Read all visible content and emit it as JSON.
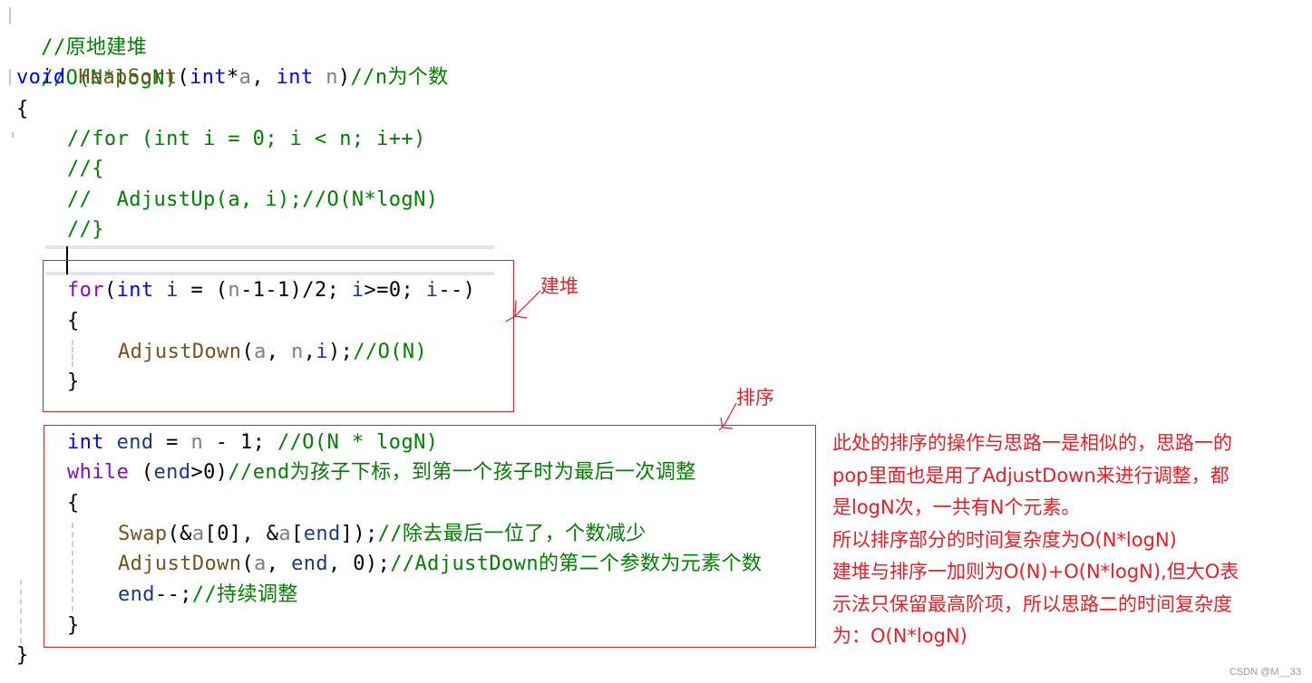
{
  "code": {
    "comment_title": "//原地建堆",
    "comment_complexity": "//O(N*logN)",
    "signature": {
      "kw_void": "void",
      "fn_name": "HeapSort",
      "open": "(",
      "kw_int1": "int",
      "star": "*",
      "param_a": "a",
      "comma": ", ",
      "kw_int2": "int",
      "space": " ",
      "param_n": "n",
      "close": ")",
      "comment": "//n为个数"
    },
    "open_brace": "{",
    "close_brace": "}",
    "commented_loop": [
      "//for (int i = 0; i < n; i++)",
      "//{",
      "//  AdjustUp(a, i);//O(N*logN)",
      "//}"
    ],
    "build_heap": {
      "for_kw": "for",
      "for_open": "(",
      "int_kw": "int",
      "i_decl": " i",
      "eq": " = (",
      "n": "n",
      "rest": "-1-1)/2; ",
      "i2": "i",
      "cond": ">=0; ",
      "i3": "i",
      "dec": "--)",
      "brace_open": "{",
      "call_fn": "AdjustDown",
      "call_open": "(",
      "call_a": "a",
      "call_sep": ", ",
      "call_n": "n",
      "call_comma": ",",
      "call_i": "i",
      "call_close": ");",
      "call_comment": "//O(N)",
      "brace_close": "}"
    },
    "sort_loop": {
      "int_kw": "int",
      "end_var": " end",
      "assign": " = ",
      "n": "n",
      "minus": " - 1; ",
      "comment1": "//O(N * logN)",
      "while_kw": "while",
      "while_open": " (",
      "while_end": "end",
      "while_cond": ">0)",
      "while_comment": "//end为孩子下标，到第一个孩子时为最后一次调整",
      "brace_open": "{",
      "swap_fn": "Swap",
      "swap_open": "(&",
      "swap_a1": "a",
      "swap_idx0": "[0], &",
      "swap_a2": "a",
      "swap_lb": "[",
      "swap_end": "end",
      "swap_rb": "]);",
      "swap_comment": "//除去最后一位了，个数减少",
      "adj_fn": "AdjustDown",
      "adj_open": "(",
      "adj_a": "a",
      "adj_sep": ", ",
      "adj_end": "end",
      "adj_rest": ", 0);",
      "adj_comment": "//AdjustDown的第二个参数为元素个数",
      "dec_end": "end",
      "dec_op": "--;",
      "dec_comment": "//持续调整",
      "brace_close": "}"
    }
  },
  "annotations": {
    "build_heap_label": "建堆",
    "sort_label": "排序",
    "explanation": [
      "此处的排序的操作与思路一是相似的，思路一的",
      "pop里面也是用了AdjustDown来进行调整，都",
      "是logN次，一共有N个元素。",
      "所以排序部分的时间复杂度为O(N*logN)",
      "建堆与排序一加则为O(N)+O(N*logN),但大O表",
      "示法只保留最高阶项，所以思路二的时间复杂度",
      "为：O(N*logN)"
    ],
    "annotation_color": "#ee1c25"
  },
  "watermark": "CSDN @M__33"
}
